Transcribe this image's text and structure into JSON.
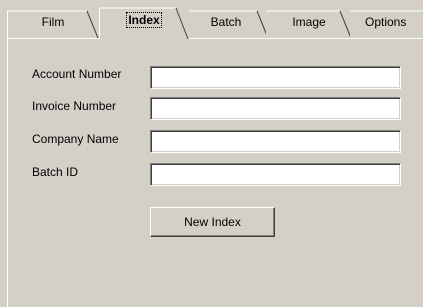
{
  "tabs": {
    "film": "Film",
    "index": "Index",
    "batch": "Batch",
    "image": "Image",
    "options": "Options"
  },
  "active_tab": "Index",
  "form": {
    "account_number": {
      "label": "Account Number",
      "value": ""
    },
    "invoice_number": {
      "label": "Invoice Number",
      "value": ""
    },
    "company_name": {
      "label": "Company Name",
      "value": ""
    },
    "batch_id": {
      "label": "Batch ID",
      "value": ""
    }
  },
  "buttons": {
    "new_index": "New Index"
  },
  "colors": {
    "face": "#d4d0c8",
    "highlight": "#ffffff",
    "shadow": "#808080",
    "dark_shadow": "#404040"
  }
}
